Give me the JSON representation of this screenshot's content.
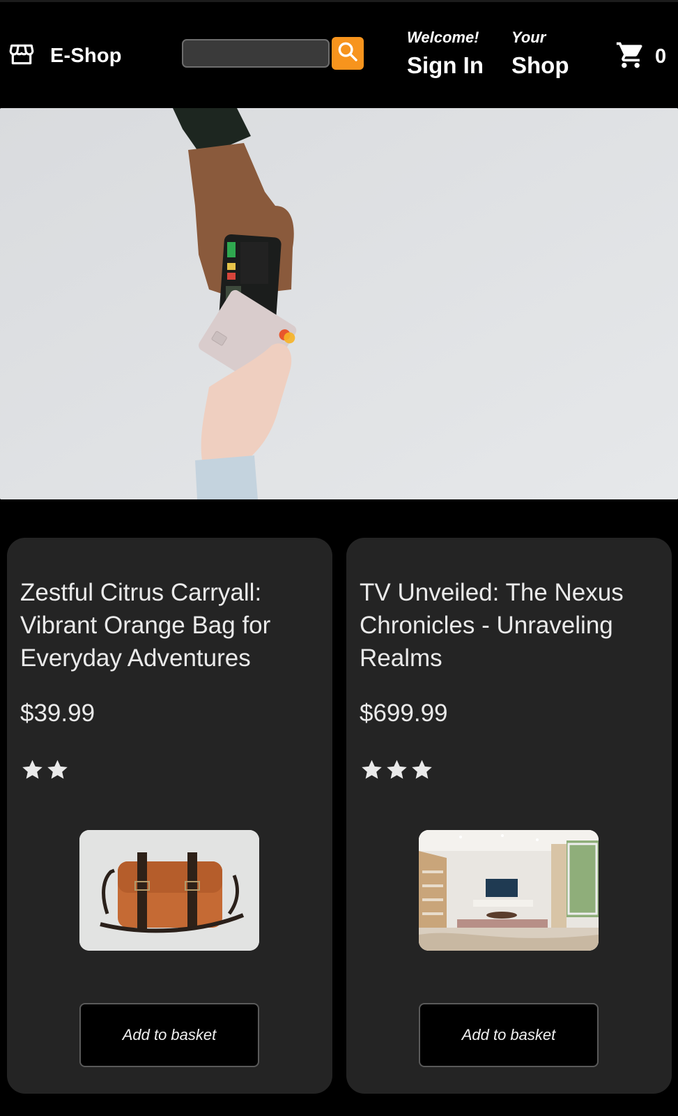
{
  "header": {
    "logo_text": "E-Shop",
    "search": {
      "value": "",
      "placeholder": ""
    },
    "nav": [
      {
        "line1": "Welcome!",
        "line2": "Sign In"
      },
      {
        "line1": "Your",
        "line2": "Shop"
      }
    ],
    "basket_count": "0"
  },
  "colors": {
    "accent": "#f7941d",
    "background": "#000000",
    "card": "#242424"
  },
  "hero": {
    "image": "hand-passing-card-payment-terminal"
  },
  "products": [
    {
      "title": "Zestful Citrus Carryall: Vibrant Orange Bag for Everyday Adventures",
      "price": "$39.99",
      "rating": 2,
      "image": "orange-leather-bag",
      "button_label": "Add to basket"
    },
    {
      "title": "TV Unveiled: The Nexus Chronicles - Unraveling Realms",
      "price": "$699.99",
      "rating": 3,
      "image": "living-room-tv",
      "button_label": "Add to basket"
    }
  ]
}
